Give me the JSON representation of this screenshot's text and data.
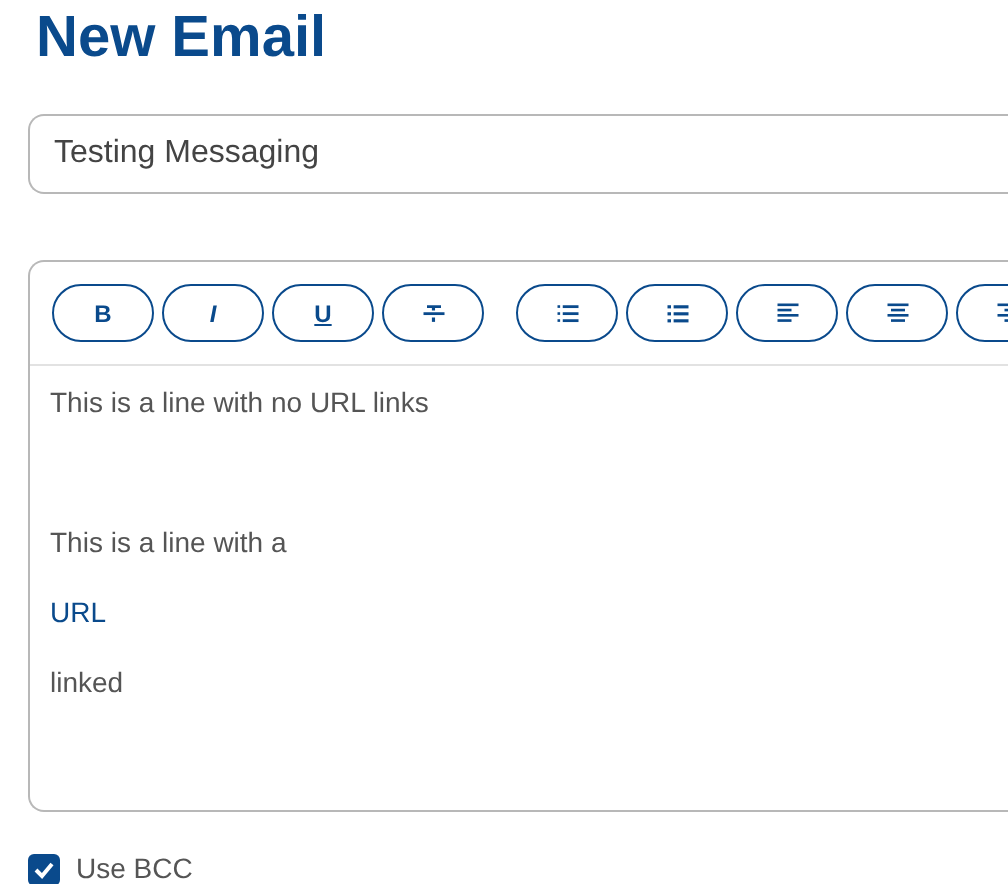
{
  "title": "New Email",
  "subject": {
    "value": "Testing Messaging"
  },
  "toolbar": [
    {
      "kind": "bold",
      "label": "B"
    },
    {
      "kind": "italic",
      "label": "I"
    },
    {
      "kind": "underline",
      "label": "U"
    },
    {
      "kind": "strike"
    },
    {
      "kind": "ordered-list"
    },
    {
      "kind": "bullet-list"
    },
    {
      "kind": "align-left"
    },
    {
      "kind": "align-center"
    },
    {
      "kind": "align-right"
    }
  ],
  "body": [
    {
      "kind": "text",
      "text": "This is a line with no URL links"
    },
    {
      "kind": "blank"
    },
    {
      "kind": "text",
      "text": "This is a line with a"
    },
    {
      "kind": "link",
      "text": "URL"
    },
    {
      "kind": "text",
      "text": "linked"
    }
  ],
  "use_bcc": {
    "label": "Use BCC",
    "checked": true
  }
}
